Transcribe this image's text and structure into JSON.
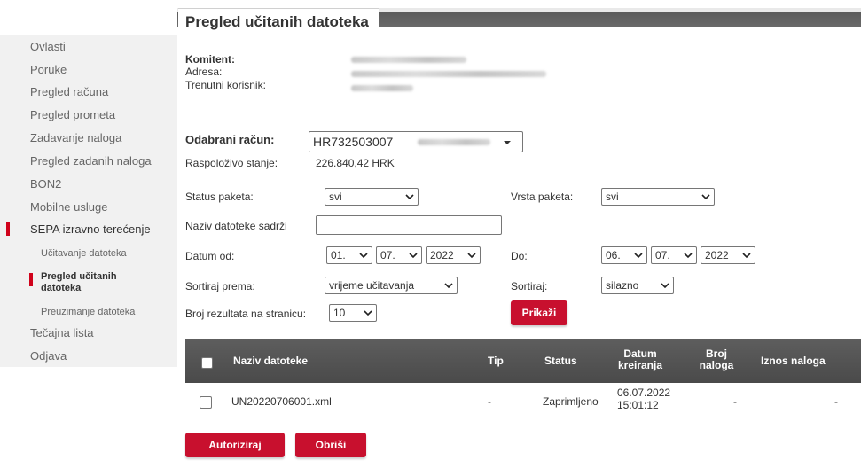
{
  "page": {
    "title": "Pregled učitanih datoteka"
  },
  "sidebar": {
    "items": [
      {
        "label": "Ovlasti"
      },
      {
        "label": "Poruke"
      },
      {
        "label": "Pregled računa"
      },
      {
        "label": "Pregled prometa"
      },
      {
        "label": "Zadavanje naloga"
      },
      {
        "label": "Pregled zadanih naloga"
      },
      {
        "label": "BON2"
      },
      {
        "label": "Mobilne usluge"
      },
      {
        "label": "SEPA izravno terećenje"
      },
      {
        "label": "Tečajna lista"
      },
      {
        "label": "Odjava"
      }
    ],
    "sub_items": [
      {
        "label": "Učitavanje datoteka"
      },
      {
        "label": "Pregled učitanih datoteka"
      },
      {
        "label": "Preuzimanje datoteka"
      }
    ],
    "accent_color": "#d0021b"
  },
  "client": {
    "komitent_label": "Komitent:",
    "adresa_label": "Adresa:",
    "korisnik_label": "Trenutni korisnik:"
  },
  "account": {
    "label": "Odabrani račun:",
    "value": "HR732503007",
    "balance_label": "Raspoloživo stanje:",
    "balance_value": "226.840,42 HRK"
  },
  "filters": {
    "status_label": "Status paketa:",
    "status_value": "svi",
    "vrsta_label": "Vrsta paketa:",
    "vrsta_value": "svi",
    "naziv_label": "Naziv datoteke sadrži",
    "naziv_value": "",
    "datum_od_label": "Datum od:",
    "od_day": "01.",
    "od_month": "07.",
    "od_year": "2022",
    "do_label": "Do:",
    "do_day": "06.",
    "do_month": "07.",
    "do_year": "2022",
    "sort_label": "Sortiraj prema:",
    "sort_value": "vrijeme učitavanja",
    "order_label": "Sortiraj:",
    "order_value": "silazno",
    "per_page_label": "Broj rezultata na stranicu:",
    "per_page_value": "10",
    "show_button": "Prikaži"
  },
  "table": {
    "headers": {
      "naziv": "Naziv datoteke",
      "tip": "Tip",
      "status": "Status",
      "datum_line1": "Datum",
      "datum_line2": "kreiranja",
      "broj_line1": "Broj",
      "broj_line2": "naloga",
      "iznos": "Iznos naloga"
    },
    "rows": [
      {
        "naziv": "UN20220706001.xml",
        "tip": "-",
        "status": "Zaprimljeno",
        "datum": "06.07.2022",
        "vrijeme": "15:01:12",
        "broj": "-",
        "iznos": "-"
      }
    ]
  },
  "actions": {
    "authorize": "Autoriziraj",
    "delete": "Obriši"
  },
  "colors": {
    "brand_red": "#c8102e",
    "header_dark": "#555555"
  }
}
